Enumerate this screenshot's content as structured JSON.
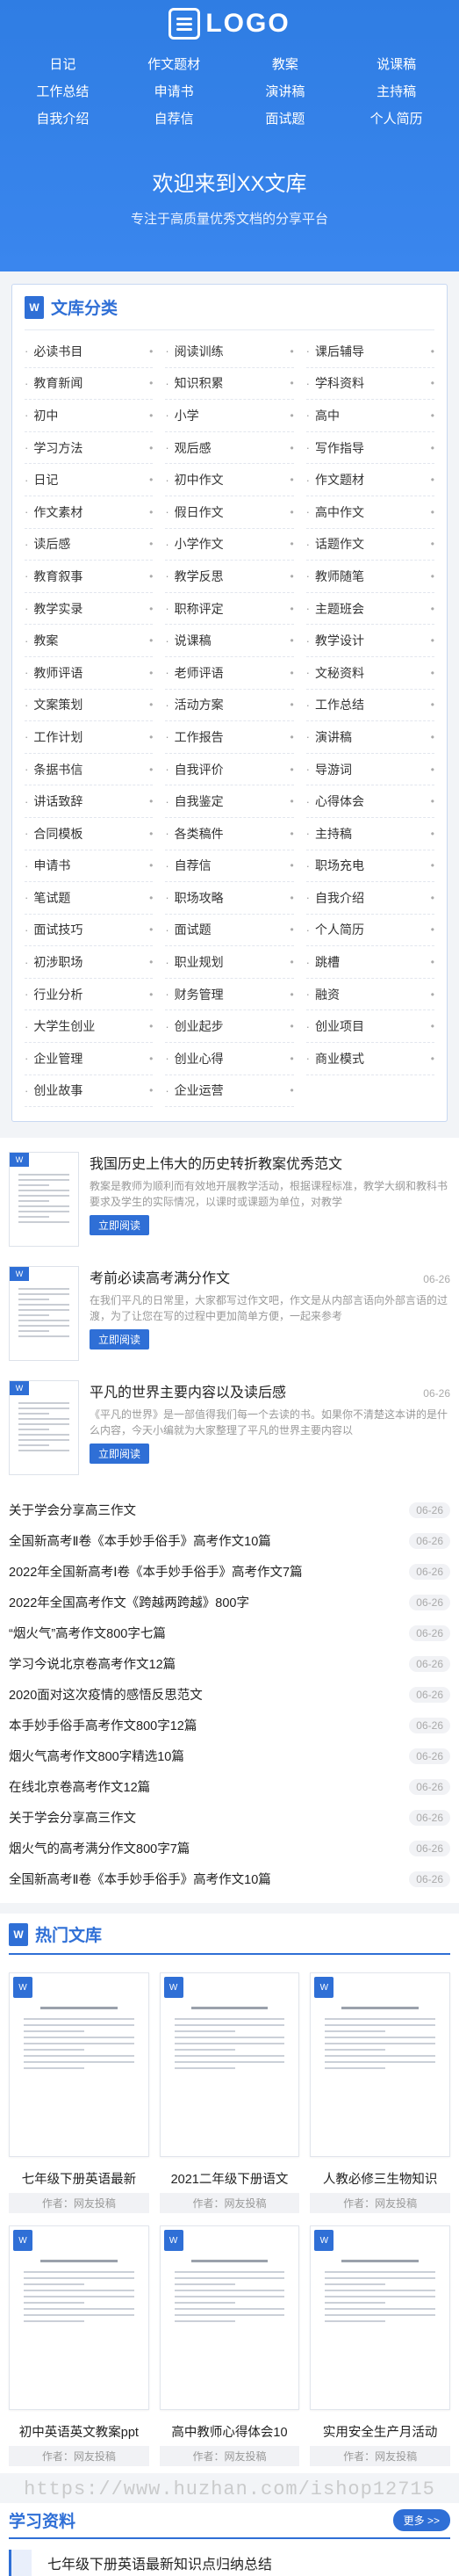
{
  "brand": {
    "logo_text": "LOGO"
  },
  "nav": [
    "日记",
    "作文题材",
    "教案",
    "说课稿",
    "工作总结",
    "申请书",
    "演讲稿",
    "主持稿",
    "自我介绍",
    "自荐信",
    "面试题",
    "个人简历"
  ],
  "hero": {
    "title": "欢迎来到XX文库",
    "subtitle": "专注于高质量优秀文档的分享平台"
  },
  "categories": {
    "title": "文库分类",
    "items": [
      "必读书目",
      "阅读训练",
      "课后辅导",
      "教育新闻",
      "知识积累",
      "学科资料",
      "初中",
      "小学",
      "高中",
      "学习方法",
      "观后感",
      "写作指导",
      "日记",
      "初中作文",
      "作文题材",
      "作文素材",
      "假日作文",
      "高中作文",
      "读后感",
      "小学作文",
      "话题作文",
      "教育叙事",
      "教学反思",
      "教师随笔",
      "教学实录",
      "职称评定",
      "主题班会",
      "教案",
      "说课稿",
      "教学设计",
      "教师评语",
      "老师评语",
      "文秘资料",
      "文案策划",
      "活动方案",
      "工作总结",
      "工作计划",
      "工作报告",
      "演讲稿",
      "条据书信",
      "自我评价",
      "导游词",
      "讲话致辞",
      "自我鉴定",
      "心得体会",
      "合同模板",
      "各类稿件",
      "主持稿",
      "申请书",
      "自荐信",
      "职场充电",
      "笔试题",
      "职场攻略",
      "自我介绍",
      "面试技巧",
      "面试题",
      "个人简历",
      "初涉职场",
      "职业规划",
      "跳槽",
      "行业分析",
      "财务管理",
      "融资",
      "大学生创业",
      "创业起步",
      "创业项目",
      "企业管理",
      "创业心得",
      "商业模式",
      "创业故事",
      "企业运营"
    ]
  },
  "featured": [
    {
      "title": "我国历史上伟大的历史转折教案优秀范文",
      "date": "",
      "desc": "教案是教师为顺利而有效地开展教学活动，根据课程标准，教学大纲和教科书要求及学生的实际情况，以课时或课题为单位，对教学",
      "button": "立即阅读"
    },
    {
      "title": "考前必读高考满分作文",
      "date": "06-26",
      "desc": "在我们平凡的日常里，大家都写过作文吧，作文是从内部言语向外部言语的过渡，为了让您在写的过程中更加简单方便，一起来参考",
      "button": "立即阅读"
    },
    {
      "title": "平凡的世界主要内容以及读后感",
      "date": "06-26",
      "desc": "《平凡的世界》是一部值得我们每一个去读的书。如果你不清楚这本讲的是什么内容，今天小编就为大家整理了平凡的世界主要内容以",
      "button": "立即阅读"
    }
  ],
  "articles": [
    {
      "title": "关于学会分享高三作文",
      "date": "06-26"
    },
    {
      "title": "全国新高考Ⅱ卷《本手妙手俗手》高考作文10篇",
      "date": "06-26"
    },
    {
      "title": "2022年全国新高考Ⅰ卷《本手妙手俗手》高考作文7篇",
      "date": "06-26"
    },
    {
      "title": "2022年全国高考作文《跨越两跨越》800字",
      "date": "06-26"
    },
    {
      "title": "“烟火气”高考作文800字七篇",
      "date": "06-26"
    },
    {
      "title": "学习今说北京卷高考作文12篇",
      "date": "06-26"
    },
    {
      "title": "2020面对这次疫情的感悟反思范文",
      "date": "06-26"
    },
    {
      "title": "本手妙手俗手高考作文800字12篇",
      "date": "06-26"
    },
    {
      "title": "烟火气高考作文800字精选10篇",
      "date": "06-26"
    },
    {
      "title": "在线北京卷高考作文12篇",
      "date": "06-26"
    },
    {
      "title": "关于学会分享高三作文",
      "date": "06-26"
    },
    {
      "title": "烟火气的高考满分作文800字7篇",
      "date": "06-26"
    },
    {
      "title": "全国新高考Ⅱ卷《本手妙手俗手》高考作文10篇",
      "date": "06-26"
    }
  ],
  "hot": {
    "title": "热门文库",
    "items": [
      {
        "title": "七年级下册英语最新",
        "author": "作者：网友投稿"
      },
      {
        "title": "2021二年级下册语文",
        "author": "作者：网友投稿"
      },
      {
        "title": "人教必修三生物知识",
        "author": "作者：网友投稿"
      },
      {
        "title": "初中英语英文教案ppt",
        "author": "作者：网友投稿"
      },
      {
        "title": "高中教师心得体会10",
        "author": "作者：网友投稿"
      },
      {
        "title": "实用安全生产月活动",
        "author": "作者：网友投稿"
      }
    ]
  },
  "watermark": "https://www.huzhan.com/ishop12715",
  "study": {
    "title": "学习资料",
    "more": "更多 >>",
    "first_item": "七年级下册英语最新知识点归纳总结"
  },
  "colors": {
    "primary": "#2f6fd6",
    "header_bg": "#3a86ee"
  }
}
